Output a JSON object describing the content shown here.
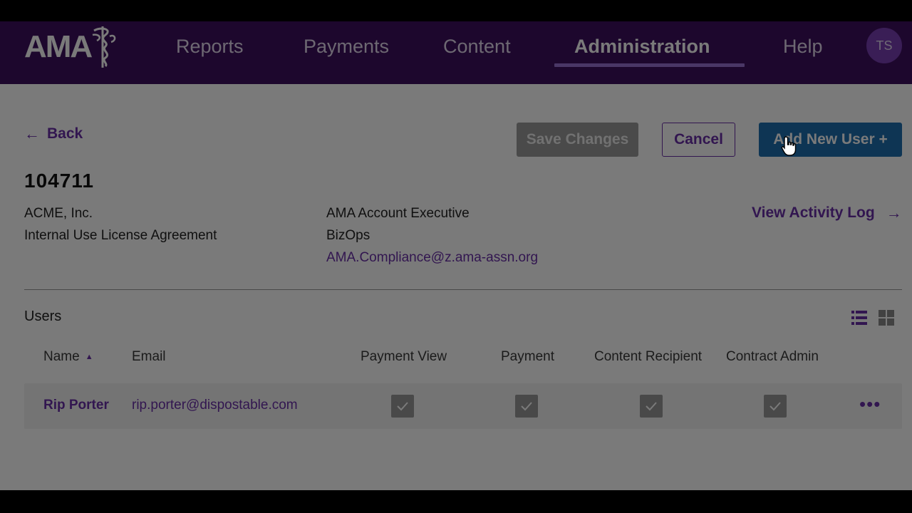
{
  "header": {
    "logo_text": "AMA",
    "nav": [
      {
        "label": "Reports"
      },
      {
        "label": "Payments"
      },
      {
        "label": "Content"
      },
      {
        "label": "Administration",
        "active": true
      },
      {
        "label": "Help"
      }
    ],
    "avatar_initials": "TS"
  },
  "actions": {
    "back_label": "Back",
    "save_label": "Save Changes",
    "cancel_label": "Cancel",
    "add_user_label": "Add New User +"
  },
  "account": {
    "id": "104711",
    "company": "ACME, Inc.",
    "agreement": "Internal Use License Agreement",
    "exec_label": "AMA Account Executive",
    "exec_team": "BizOps",
    "exec_email": "AMA.Compliance@z.ama-assn.org",
    "activity_log_label": "View Activity Log"
  },
  "users": {
    "title": "Users",
    "columns": [
      "Name",
      "Email",
      "Payment View",
      "Payment",
      "Content Recipient",
      "Contract Admin"
    ],
    "rows": [
      {
        "name": "Rip Porter",
        "email": "rip.porter@dispostable.com",
        "payment_view": true,
        "payment": true,
        "content_recipient": true,
        "contract_admin": true
      }
    ]
  },
  "colors": {
    "header_bg": "#3e0f5e",
    "accent": "#6a2fa8",
    "primary_button": "#1f6fb0",
    "disabled_button": "#9c9c9c"
  },
  "icons": [
    "arrow-left-icon",
    "arrow-right-icon",
    "list-view-icon",
    "grid-view-icon",
    "sort-asc-icon",
    "check-icon",
    "more-icon",
    "hand-cursor-icon",
    "caduceus-icon"
  ]
}
